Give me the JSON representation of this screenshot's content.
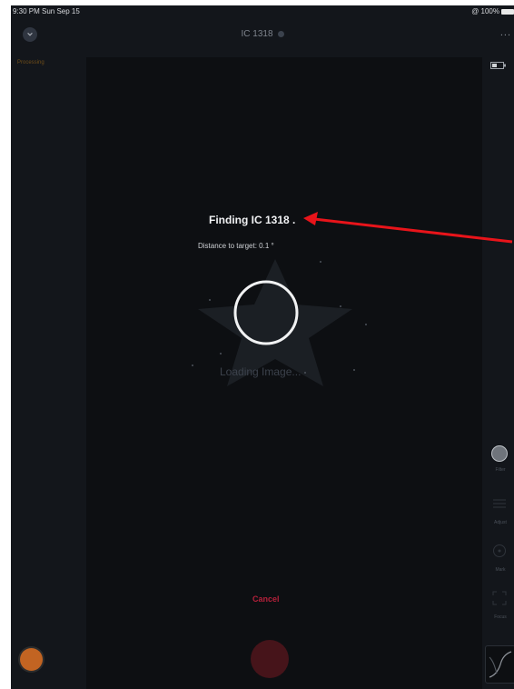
{
  "status_bar": {
    "time": "9:30 PM  Sun Sep 15",
    "battery": "@ 100%"
  },
  "nav": {
    "title": "IC 1318",
    "more": "..."
  },
  "processing": "Processing",
  "finding": "Finding IC 1318 .",
  "distance": "Distance to target: 0.1 °",
  "loading": "Loading Image...",
  "cancel": "Cancel",
  "side_tools": {
    "filter": "Filter",
    "adjust": "Adjust",
    "mark": "Mark",
    "focus": "Focus"
  },
  "colors": {
    "background": "#13161b",
    "panel": "#0d0f12",
    "cancel": "#b3203a",
    "shutter": "#46141a",
    "thumbnail": "#c26422",
    "annotation_arrow": "#e8141a"
  },
  "icons": [
    "close-icon",
    "info-icon",
    "more-icon",
    "fullscreen-icon",
    "battery-icon",
    "filter-icon",
    "adjust-icon",
    "mark-icon",
    "focus-icon",
    "curve-icon",
    "spinner-icon",
    "arrow-icon"
  ]
}
